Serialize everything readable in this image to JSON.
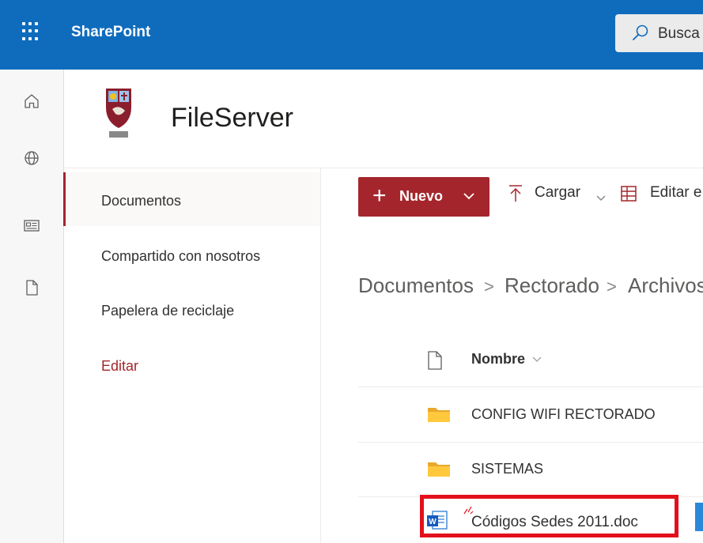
{
  "suitebar": {
    "app_name": "SharePoint",
    "search_placeholder": "Busca",
    "background": "#0f6cbd"
  },
  "rail": {
    "icons": [
      "home-icon",
      "globe-icon",
      "news-icon",
      "file-icon"
    ]
  },
  "site": {
    "title": "FileServer",
    "logo": "university-crest-logo"
  },
  "left_nav": {
    "items": [
      {
        "label": "Documentos",
        "selected": true
      },
      {
        "label": "Compartido con nosotros"
      },
      {
        "label": "Papelera de reciclaje"
      },
      {
        "label": "Editar"
      }
    ],
    "accent": "#a4262c"
  },
  "command_bar": {
    "new_label": "Nuevo",
    "upload_label": "Cargar",
    "edit_label": "Editar e"
  },
  "breadcrumb": {
    "items": [
      "Documentos",
      "Rectorado",
      "Archivos"
    ],
    "separator": ">"
  },
  "list": {
    "header_name": "Nombre",
    "rows": [
      {
        "name": "CONFIG WIFI RECTORADO",
        "type": "folder"
      },
      {
        "name": "SISTEMAS",
        "type": "folder"
      },
      {
        "name": "Códigos Sedes 2011.doc",
        "type": "word-doc",
        "highlighted": true
      }
    ],
    "highlight_color": "#e3101c"
  }
}
